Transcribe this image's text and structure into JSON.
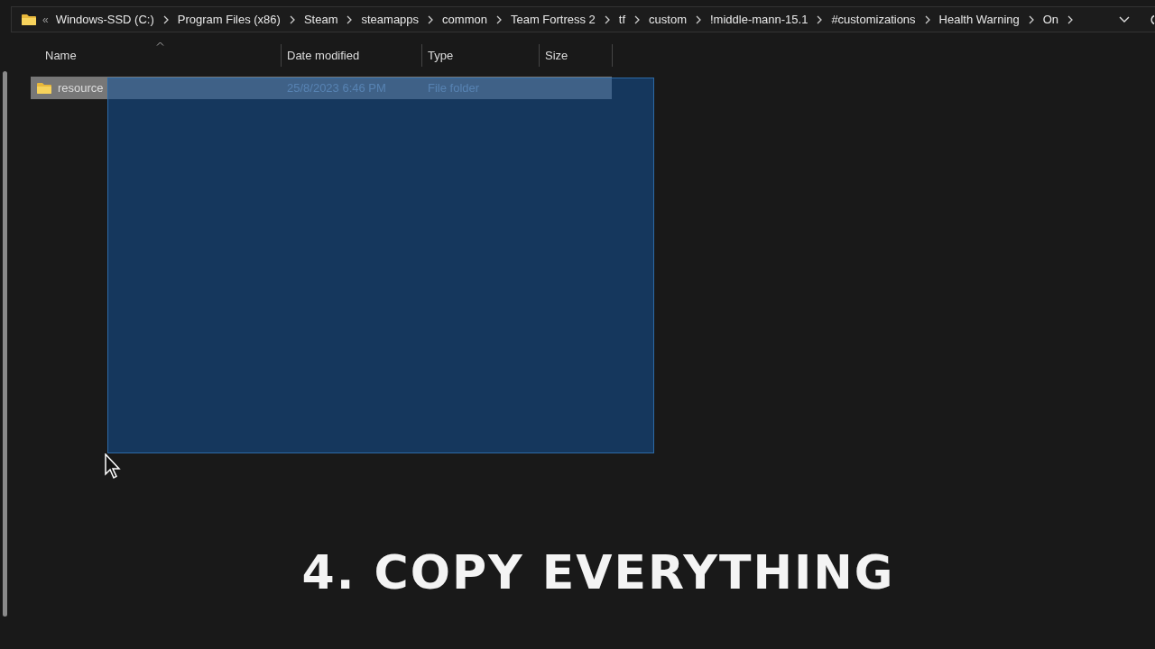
{
  "address_bar": {
    "overflow": "«",
    "crumbs": [
      "Windows-SSD (C:)",
      "Program Files (x86)",
      "Steam",
      "steamapps",
      "common",
      "Team Fortress 2",
      "tf",
      "custom",
      "!middle-mann-15.1",
      "#customizations",
      "Health Warning",
      "On"
    ]
  },
  "columns": [
    {
      "label": "Name",
      "sorted": true
    },
    {
      "label": "Date modified",
      "sorted": false
    },
    {
      "label": "Type",
      "sorted": false
    },
    {
      "label": "Size",
      "sorted": false
    }
  ],
  "rows": [
    {
      "name": "resource",
      "date": "25/8/2023 6:46 PM",
      "type": "File folder",
      "selected": true
    }
  ],
  "marquee": {
    "shown": true
  },
  "caption": "4. COPY EVERYTHING"
}
